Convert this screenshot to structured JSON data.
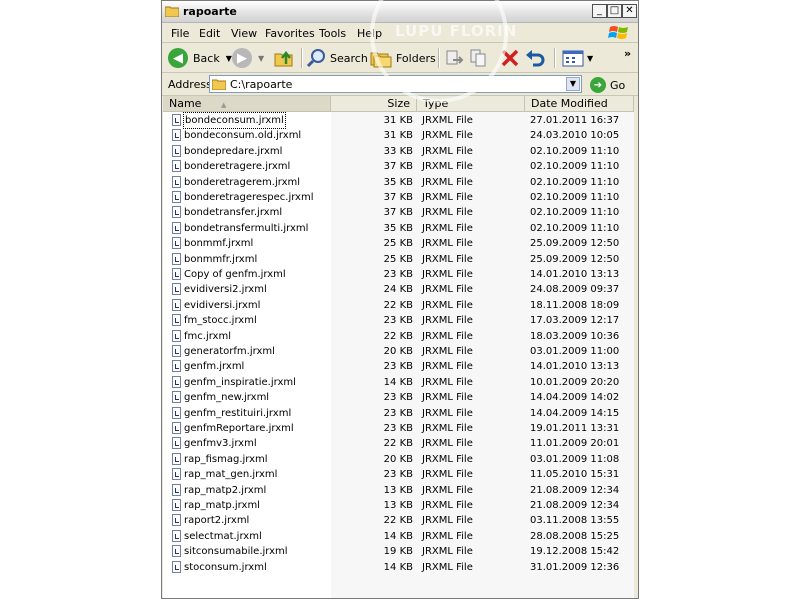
{
  "window": {
    "title": "rapoarte",
    "controls": {
      "minimize": "_",
      "maximize": "□",
      "close": "✕"
    }
  },
  "menu": [
    "File",
    "Edit",
    "View",
    "Favorites",
    "Tools",
    "Help"
  ],
  "toolbar": {
    "back_label": "Back",
    "search_label": "Search",
    "folders_label": "Folders"
  },
  "address": {
    "label": "Address",
    "value": "C:\\rapoarte",
    "go_label": "Go"
  },
  "columns": {
    "name": "Name",
    "size": "Size",
    "type": "Type",
    "date": "Date Modified"
  },
  "watermark": "LUPU FLORIN",
  "files": [
    {
      "name": "bondeconsum.jrxml",
      "size": "31 KB",
      "type": "JRXML File",
      "date": "27.01.2011 16:37"
    },
    {
      "name": "bondeconsum.old.jrxml",
      "size": "31 KB",
      "type": "JRXML File",
      "date": "24.03.2010 10:05"
    },
    {
      "name": "bondepredare.jrxml",
      "size": "33 KB",
      "type": "JRXML File",
      "date": "02.10.2009 11:10"
    },
    {
      "name": "bonderetragere.jrxml",
      "size": "37 KB",
      "type": "JRXML File",
      "date": "02.10.2009 11:10"
    },
    {
      "name": "bonderetragerem.jrxml",
      "size": "35 KB",
      "type": "JRXML File",
      "date": "02.10.2009 11:10"
    },
    {
      "name": "bonderetragerespec.jrxml",
      "size": "37 KB",
      "type": "JRXML File",
      "date": "02.10.2009 11:10"
    },
    {
      "name": "bondetransfer.jrxml",
      "size": "37 KB",
      "type": "JRXML File",
      "date": "02.10.2009 11:10"
    },
    {
      "name": "bondetransfermulti.jrxml",
      "size": "35 KB",
      "type": "JRXML File",
      "date": "02.10.2009 11:10"
    },
    {
      "name": "bonmmf.jrxml",
      "size": "25 KB",
      "type": "JRXML File",
      "date": "25.09.2009 12:50"
    },
    {
      "name": "bonmmfr.jrxml",
      "size": "25 KB",
      "type": "JRXML File",
      "date": "25.09.2009 12:50"
    },
    {
      "name": "Copy of genfm.jrxml",
      "size": "23 KB",
      "type": "JRXML File",
      "date": "14.01.2010 13:13"
    },
    {
      "name": "evidiversi2.jrxml",
      "size": "24 KB",
      "type": "JRXML File",
      "date": "24.08.2009 09:37"
    },
    {
      "name": "evidiversi.jrxml",
      "size": "22 KB",
      "type": "JRXML File",
      "date": "18.11.2008 18:09"
    },
    {
      "name": "fm_stocc.jrxml",
      "size": "23 KB",
      "type": "JRXML File",
      "date": "17.03.2009 12:17"
    },
    {
      "name": "fmc.jrxml",
      "size": "22 KB",
      "type": "JRXML File",
      "date": "18.03.2009 10:36"
    },
    {
      "name": "generatorfm.jrxml",
      "size": "20 KB",
      "type": "JRXML File",
      "date": "03.01.2009 11:00"
    },
    {
      "name": "genfm.jrxml",
      "size": "23 KB",
      "type": "JRXML File",
      "date": "14.01.2010 13:13"
    },
    {
      "name": "genfm_inspiratie.jrxml",
      "size": "14 KB",
      "type": "JRXML File",
      "date": "10.01.2009 20:20"
    },
    {
      "name": "genfm_new.jrxml",
      "size": "23 KB",
      "type": "JRXML File",
      "date": "14.04.2009 14:02"
    },
    {
      "name": "genfm_restituiri.jrxml",
      "size": "23 KB",
      "type": "JRXML File",
      "date": "14.04.2009 14:15"
    },
    {
      "name": "genfmReportare.jrxml",
      "size": "23 KB",
      "type": "JRXML File",
      "date": "19.01.2011 13:31"
    },
    {
      "name": "genfmv3.jrxml",
      "size": "22 KB",
      "type": "JRXML File",
      "date": "11.01.2009 20:01"
    },
    {
      "name": "rap_fismag.jrxml",
      "size": "20 KB",
      "type": "JRXML File",
      "date": "03.01.2009 11:08"
    },
    {
      "name": "rap_mat_gen.jrxml",
      "size": "23 KB",
      "type": "JRXML File",
      "date": "11.05.2010 15:31"
    },
    {
      "name": "rap_matp2.jrxml",
      "size": "13 KB",
      "type": "JRXML File",
      "date": "21.08.2009 12:34"
    },
    {
      "name": "rap_matp.jrxml",
      "size": "13 KB",
      "type": "JRXML File",
      "date": "21.08.2009 12:34"
    },
    {
      "name": "raport2.jrxml",
      "size": "22 KB",
      "type": "JRXML File",
      "date": "03.11.2008 13:55"
    },
    {
      "name": "selectmat.jrxml",
      "size": "14 KB",
      "type": "JRXML File",
      "date": "28.08.2008 15:25"
    },
    {
      "name": "sitconsumabile.jrxml",
      "size": "19 KB",
      "type": "JRXML File",
      "date": "19.12.2008 15:42"
    },
    {
      "name": "stoconsum.jrxml",
      "size": "14 KB",
      "type": "JRXML File",
      "date": "31.01.2009 12:36"
    }
  ]
}
